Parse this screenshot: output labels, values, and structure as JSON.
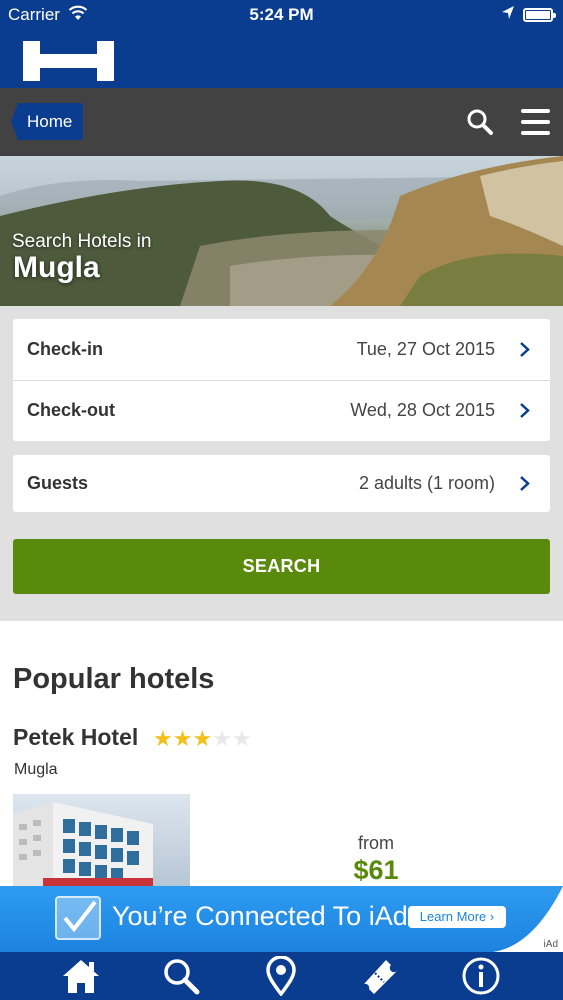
{
  "status_bar": {
    "carrier": "Carrier",
    "time": "5:24 PM",
    "icons": [
      "wifi-icon",
      "location-arrow-icon",
      "battery-icon"
    ]
  },
  "brand": {
    "logo_icon": "hotel-h-logo-icon",
    "color": "#0a3d8f"
  },
  "nav": {
    "home_label": "Home",
    "icons": [
      "search-icon",
      "menu-icon"
    ]
  },
  "hero": {
    "subtitle": "Search Hotels in",
    "city": "Mugla"
  },
  "form": {
    "checkin_label": "Check-in",
    "checkin_value": "Tue, 27 Oct 2015",
    "checkout_label": "Check-out",
    "checkout_value": "Wed, 28 Oct 2015",
    "guests_label": "Guests",
    "guests_value": "2 adults (1 room)",
    "search_label": "SEARCH",
    "search_color": "#5a8a0c"
  },
  "popular": {
    "title": "Popular hotels",
    "hotels": [
      {
        "name": "Petek Hotel",
        "stars": 3,
        "max_stars": 5,
        "city": "Mugla",
        "from_label": "from",
        "price": "$61"
      }
    ]
  },
  "ad": {
    "text": "You’re Connected To iAd",
    "button": "Learn More ›",
    "mark": "iAd"
  },
  "tabs": [
    "home-icon",
    "search-icon",
    "location-pin-icon",
    "ticket-icon",
    "info-icon"
  ]
}
